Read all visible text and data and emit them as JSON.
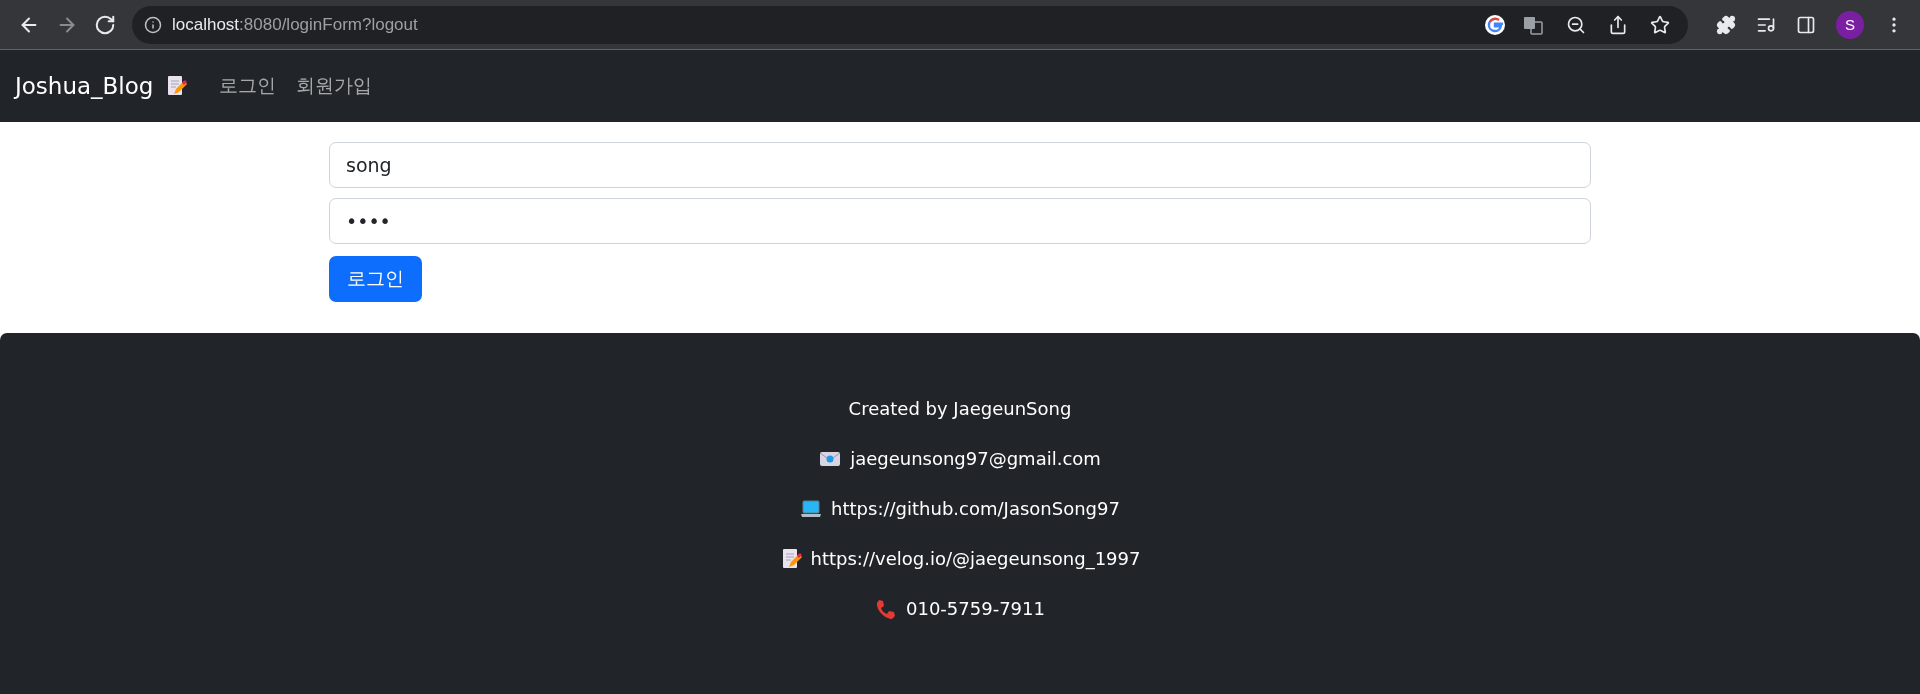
{
  "browser": {
    "nav_buttons": [
      {
        "kind": "back",
        "disabled": false
      },
      {
        "kind": "forward",
        "disabled": true
      },
      {
        "kind": "reload",
        "disabled": false
      }
    ],
    "url": {
      "host": "localhost",
      "rest": ":8080/loginForm?logout"
    },
    "profile_initial": "S"
  },
  "navbar": {
    "brand": "Joshua_Blog",
    "links": [
      {
        "label": "로그인"
      },
      {
        "label": "회원가입"
      }
    ]
  },
  "form": {
    "username": {
      "value": "song"
    },
    "password": {
      "value": "••••"
    },
    "submit": "로그인"
  },
  "footer": {
    "lines": [
      {
        "kind": "plain",
        "text": "Created by JaegeunSong"
      },
      {
        "kind": "mail",
        "text": "jaegeunsong97@gmail.com"
      },
      {
        "kind": "laptop",
        "text": "https://github.com/JasonSong97"
      },
      {
        "kind": "memo",
        "text": "https://velog.io/@jaegeunsong_1997"
      },
      {
        "kind": "phone",
        "text": "010-5759-7911"
      }
    ]
  }
}
